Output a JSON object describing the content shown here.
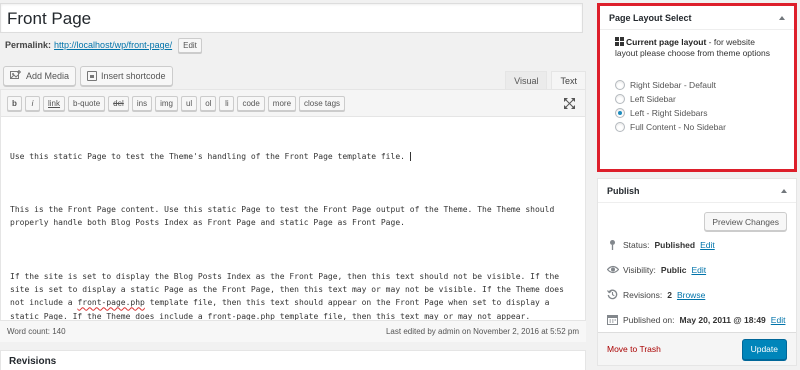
{
  "title_field": {
    "value": "Front Page"
  },
  "permalink": {
    "label": "Permalink:",
    "url": "http://localhost/wp/front-page/",
    "edit_label": "Edit"
  },
  "media_buttons": {
    "add_media": "Add Media",
    "insert_shortcode": "Insert shortcode"
  },
  "editor_tabs": {
    "visual": "Visual",
    "text": "Text",
    "active": "Text"
  },
  "quicktags": [
    "b",
    "i",
    "link",
    "b-quote",
    "del",
    "ins",
    "img",
    "ul",
    "ol",
    "li",
    "code",
    "more",
    "close tags"
  ],
  "content": {
    "p1": "Use this static Page to test the Theme's handling of the Front Page template file. ",
    "p2": "This is the Front Page content. Use this static Page to test the Front Page output of the Theme. The Theme should properly handle both Blog Posts Index as Front Page and static Page as Front Page.",
    "p3_a": "If the site is set to display the Blog Posts Index as the Front Page, then this text should not be visible. If the site is set to display a static Page as the Front Page, then this text may or may not be visible. If the Theme does not include a ",
    "p3_b": "front-page.php",
    "p3_c": " template file, then this text should appear on the Front Page when set to display a static Page. If the Theme does include a ",
    "p3_d": "front-page.php",
    "p3_e": " template file, then this text may or may not appear."
  },
  "status_bar": {
    "word_count": "Word count: 140",
    "last_edited": "Last edited by admin on November 2, 2016 at 5:52 pm"
  },
  "revisions_box": {
    "title": "Revisions"
  },
  "layout_box": {
    "title": "Page Layout Select",
    "desc_bold": "Current page layout",
    "desc_rest": " - for website layout please choose from theme options",
    "options": [
      {
        "label": "Right Sidebar - Default",
        "checked": false
      },
      {
        "label": "Left Sidebar",
        "checked": false
      },
      {
        "label": "Left - Right Sidebars",
        "checked": true
      },
      {
        "label": "Full Content - No Sidebar",
        "checked": false
      }
    ]
  },
  "publish_box": {
    "title": "Publish",
    "preview_label": "Preview Changes",
    "status_label": "Status:",
    "status_value": "Published",
    "visibility_label": "Visibility:",
    "visibility_value": "Public",
    "revisions_label": "Revisions:",
    "revisions_value": "2",
    "browse_label": "Browse",
    "published_label": "Published on:",
    "published_value": "May 20, 2011 @ 18:49",
    "edit_label": "Edit",
    "trash_label": "Move to Trash",
    "update_label": "Update"
  },
  "colors": {
    "accent": "#0073aa",
    "highlight_border": "#dd1f2b",
    "primary_button": "#0085ba",
    "trash": "#a00000"
  }
}
